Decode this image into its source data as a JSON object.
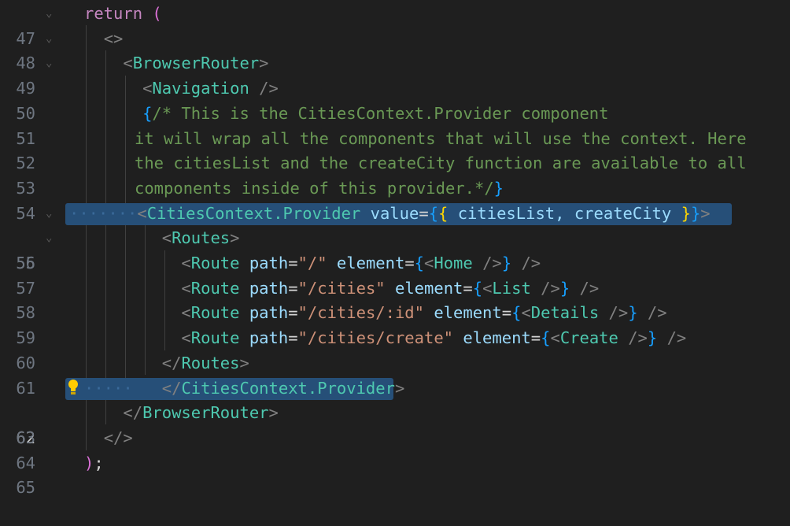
{
  "editor": {
    "line_numbers": [
      "47",
      "48",
      "49",
      "50",
      "51",
      "52",
      "53",
      "54",
      "55",
      "56",
      "57",
      "58",
      "59",
      "60",
      "61",
      "62",
      "63",
      "64",
      "65"
    ],
    "active_line": "62",
    "lines": {
      "l47": {
        "kw": "return",
        "paren": "("
      },
      "l48": {
        "open": "<>"
      },
      "l49": {
        "tag": "BrowserRouter"
      },
      "l50": {
        "tag": "Navigation"
      },
      "l51": {
        "comment": "/* This is the CitiesContext.Provider component"
      },
      "l52": {
        "comment": "it will wrap all the components that will use the context. Here"
      },
      "l53": {
        "comment": "the citiesList and the createCity function are available to all"
      },
      "l54": {
        "comment": "components inside of this provider.*/"
      },
      "l55": {
        "tag": "CitiesContext.Provider",
        "attr": "value",
        "expr": "citiesList, createCity"
      },
      "l56": {
        "tag": "Routes"
      },
      "l57": {
        "tag": "Route",
        "path": "\"/\"",
        "el": "Home"
      },
      "l58": {
        "tag": "Route",
        "path": "\"/cities\"",
        "el": "List"
      },
      "l59": {
        "tag": "Route",
        "path": "\"/cities/:id\"",
        "el": "Details"
      },
      "l60": {
        "tag": "Route",
        "path": "\"/cities/create\"",
        "el": "Create"
      },
      "l61": {
        "tag": "Routes"
      },
      "l62": {
        "tag": "CitiesContext.Provider"
      },
      "l63": {
        "tag": "BrowserRouter"
      },
      "l64": {
        "close": "</>"
      },
      "l65": {
        "paren": ")",
        "semi": ";"
      }
    },
    "attr_path": "path",
    "attr_element": "element"
  },
  "colors": {
    "background": "#1f1f1f",
    "selection": "#264f78",
    "tag": "#4ec9b0",
    "comment": "#6a9955",
    "keyword": "#c586c0",
    "string": "#ce9178"
  },
  "icons": {
    "lightbulb": "lightbulb-icon",
    "fold": "chevron-down-icon"
  }
}
